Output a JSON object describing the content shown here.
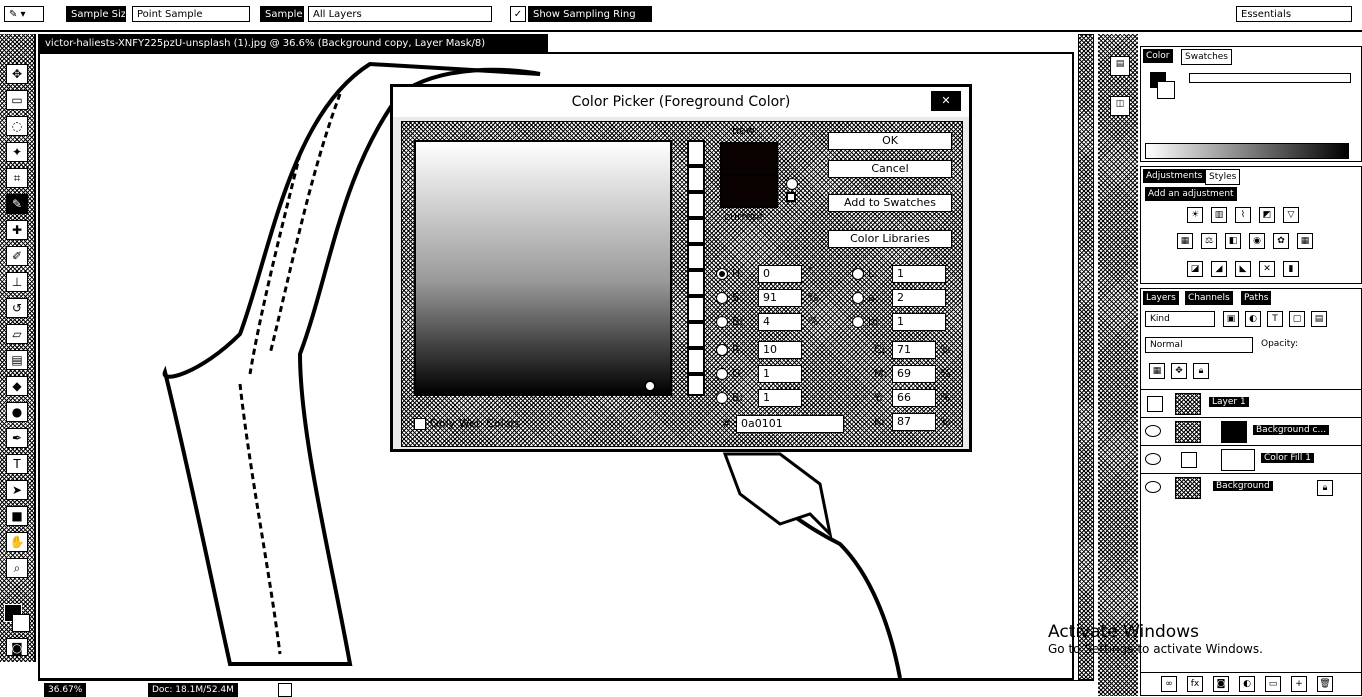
{
  "options_bar": {
    "sample_size_label": "Sample Size:",
    "sample_size_value": "Point Sample",
    "sample_label": "Sample:",
    "sample_value": "All Layers",
    "show_sampling_ring": "Show Sampling Ring",
    "workspace": "Essentials"
  },
  "document": {
    "tab_title": "victor-haliests-XNFY225pzU-unsplash (1).jpg @ 36.6% (Background copy, Layer Mask/8)",
    "zoom": "36.67%",
    "doc_size": "Doc: 18.1M/52.4M"
  },
  "dialog": {
    "title": "Color Picker (Foreground Color)",
    "new_label": "new",
    "current_label": "current",
    "buttons": {
      "ok": "OK",
      "cancel": "Cancel",
      "add_swatches": "Add to Swatches",
      "color_libraries": "Color Libraries"
    },
    "hsb": [
      {
        "label": "H:",
        "value": "0",
        "unit": "°",
        "selected": true
      },
      {
        "label": "S:",
        "value": "91",
        "unit": "%",
        "selected": false
      },
      {
        "label": "B:",
        "value": "4",
        "unit": "%",
        "selected": false
      }
    ],
    "rgb": [
      {
        "label": "R:",
        "value": "10",
        "unit": ""
      },
      {
        "label": "G:",
        "value": "1",
        "unit": ""
      },
      {
        "label": "B:",
        "value": "1",
        "unit": ""
      }
    ],
    "lab": [
      {
        "label": "L:",
        "value": "1"
      },
      {
        "label": "a:",
        "value": "2"
      },
      {
        "label": "b:",
        "value": "1"
      }
    ],
    "cmyk": [
      {
        "label": "C:",
        "value": "71",
        "unit": "%"
      },
      {
        "label": "M:",
        "value": "69",
        "unit": "%"
      },
      {
        "label": "Y:",
        "value": "66",
        "unit": "%"
      },
      {
        "label": "K:",
        "value": "87",
        "unit": "%"
      }
    ],
    "only_web_colors": "Only Web Colors",
    "hex_symbol": "#",
    "hex": "0a0101",
    "current_color": "#0a0101"
  },
  "panels": {
    "color_tab": "Color",
    "swatches_tab": "Swatches",
    "adjustments_tab": "Adjustments",
    "styles_tab": "Styles",
    "add_adjustment": "Add an adjustment",
    "layers_tab": "Layers",
    "channels_tab": "Channels",
    "paths_tab": "Paths",
    "kind_filter": "Kind",
    "blend_mode": "Normal",
    "opacity_label": "Opacity:",
    "layers": [
      {
        "name": "Layer 1"
      },
      {
        "name": "Background c..."
      },
      {
        "name": "Color Fill 1"
      },
      {
        "name": "Background"
      }
    ]
  },
  "watermark": {
    "line1": "Activate Windows",
    "line2": "Go to Settings to activate Windows."
  }
}
